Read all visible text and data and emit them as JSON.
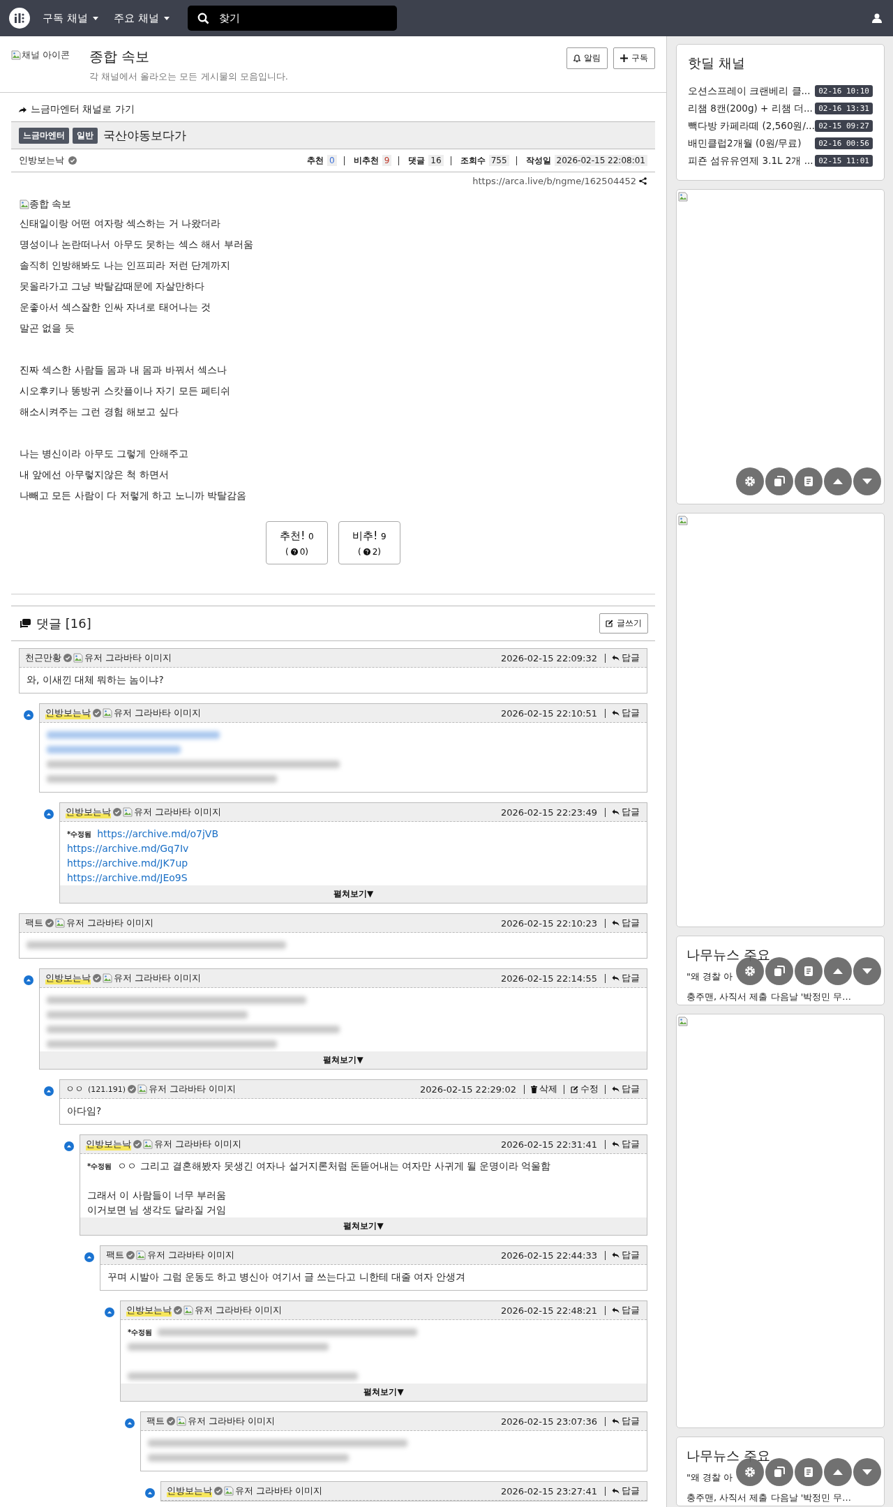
{
  "header": {
    "menus": [
      "구독 채널",
      "주요 채널"
    ],
    "search": {
      "placeholder": "찾기"
    }
  },
  "channel": {
    "icon_alt": "채널 아이콘",
    "title": "종합 속보",
    "description": "각 채널에서 올라오는 모든 게시물의 모음입니다.",
    "buttons": [
      {
        "kind": "bell",
        "label": "알림"
      },
      {
        "kind": "plus",
        "label": "구독"
      }
    ]
  },
  "post": {
    "back_link": "느금마엔터 채널로 가기",
    "badges": [
      "느금마엔터",
      "일반"
    ],
    "title": "국산야동보다가",
    "author": "인방보는낙",
    "stats": [
      {
        "kind": "up",
        "label": "추천",
        "value": "0"
      },
      {
        "kind": "down",
        "label": "비추천",
        "value": "9"
      },
      {
        "kind": "plain",
        "label": "댓글",
        "value": "16"
      },
      {
        "kind": "plain",
        "label": "조회수",
        "value": "755"
      },
      {
        "kind": "plain",
        "label": "작성일",
        "value": "2026-02-15 22:08:01"
      }
    ],
    "url": "https://arca.live/b/ngme/162504452",
    "image_alt": "종합 속보",
    "paragraphs": [
      [
        "신태일이랑 어떤 여자랑 섹스하는 거 나왔더라",
        "명성이나 논란떠나서 아무도 못하는 섹스 해서 부러움",
        "솔직히 인방해봐도 나는 인프피라 저런 단계까지",
        "못올라가고 그냥 박탈감때문에 자살만하다",
        "운좋아서 섹스잘한 인싸 자녀로 태어나는 것",
        "말곤 없을 듯"
      ],
      [
        "진짜 섹스한 사람들 몸과 내 몸과 바꿔서 섹스나",
        "시오후키나 똥방귀 스캇플이나 자기 모든 페티쉬",
        "해소시켜주는 그런 경험 해보고 싶다"
      ],
      [
        "나는 병신이라 아무도 그렇게 안해주고",
        "내 앞에선 아무렇지않은 척 하면서",
        "나빼고 모든 사람이 다 저렇게 하고 노니까 박탈감옴"
      ]
    ],
    "votes": [
      {
        "label": "추천!",
        "count": "0",
        "sub_open": "(",
        "sub": "0)"
      },
      {
        "label": "비추!",
        "count": "9",
        "sub_open": "(",
        "sub": "2)"
      }
    ]
  },
  "comments": {
    "title": "댓글 [16]",
    "write_button": "글쓰기",
    "items": [
      {
        "author": "천근만황",
        "is_author": false,
        "avatar_alt": "유저 그라바타 이미지",
        "time": "2026-02-15 22:09:32",
        "actions": [
          {
            "kind": "reply",
            "label": "답글"
          }
        ],
        "content": [
          {
            "kind": "text",
            "text": "와, 이새낀 대체 뭐하는 놈이냐?"
          }
        ],
        "children": [
          {
            "author": "인방보는낙",
            "is_author": true,
            "avatar_alt": "유저 그라바타 이미지",
            "time": "2026-02-15 22:10:51",
            "actions": [
              {
                "kind": "reply",
                "label": "답글"
              }
            ],
            "content": [
              {
                "kind": "blurred_link"
              },
              {
                "kind": "blurred_link"
              },
              {
                "kind": "blurred"
              },
              {
                "kind": "blurred"
              }
            ],
            "children": [
              {
                "author": "인방보는낙",
                "is_author": true,
                "avatar_alt": "유저 그라바타 이미지",
                "time": "2026-02-15 22:23:49",
                "actions": [
                  {
                    "kind": "reply",
                    "label": "답글"
                  }
                ],
                "edited_label": "*수정됨",
                "content": [
                  {
                    "kind": "link",
                    "text": "https://archive.md/o7jVB"
                  },
                  {
                    "kind": "link",
                    "text": "https://archive.md/Gq7Iv"
                  },
                  {
                    "kind": "link",
                    "text": "https://archive.md/JK7up"
                  },
                  {
                    "kind": "link",
                    "text": "https://archive.md/JEo9S"
                  }
                ],
                "expand_label": "펼쳐보기▼"
              }
            ]
          }
        ]
      },
      {
        "author": "팩트",
        "is_author": false,
        "avatar_alt": "유저 그라바타 이미지",
        "time": "2026-02-15 22:10:23",
        "actions": [
          {
            "kind": "reply",
            "label": "답글"
          }
        ],
        "content": [
          {
            "kind": "blurred"
          }
        ],
        "children": [
          {
            "author": "인방보는낙",
            "is_author": true,
            "avatar_alt": "유저 그라바타 이미지",
            "time": "2026-02-15 22:14:55",
            "actions": [
              {
                "kind": "reply",
                "label": "답글"
              }
            ],
            "content": [
              {
                "kind": "blurred"
              },
              {
                "kind": "blurred"
              },
              {
                "kind": "blurred"
              },
              {
                "kind": "blurred"
              }
            ],
            "expand_label": "펼쳐보기▼",
            "children": [
              {
                "author": "ㅇㅇ",
                "ip": "(121.191)",
                "is_author": false,
                "avatar_alt": "유저 그라바타 이미지",
                "time": "2026-02-15 22:29:02",
                "actions": [
                  {
                    "kind": "delete",
                    "label": "삭제"
                  },
                  {
                    "kind": "edit",
                    "label": "수정"
                  },
                  {
                    "kind": "reply",
                    "label": "답글"
                  }
                ],
                "content": [
                  {
                    "kind": "text",
                    "text": "아다임?"
                  }
                ],
                "children": [
                  {
                    "author": "인방보는낙",
                    "is_author": true,
                    "avatar_alt": "유저 그라바타 이미지",
                    "time": "2026-02-15 22:31:41",
                    "actions": [
                      {
                        "kind": "reply",
                        "label": "답글"
                      }
                    ],
                    "edited_label": "*수정됨",
                    "content": [
                      {
                        "kind": "text",
                        "text": "ㅇㅇ 그리고 결혼해봤자 못생긴 여자나 설거지론처럼 돈뜯어내는 여자만 사귀게 될 운명이라 억울함"
                      },
                      {
                        "kind": "gap"
                      },
                      {
                        "kind": "text",
                        "text": "그래서 이 사람들이 너무 부러움"
                      },
                      {
                        "kind": "text",
                        "text": "이거보면 님 생각도 달라질 거임"
                      }
                    ],
                    "expand_label": "펼쳐보기▼",
                    "children": [
                      {
                        "author": "팩트",
                        "is_author": false,
                        "avatar_alt": "유저 그라바타 이미지",
                        "time": "2026-02-15 22:44:33",
                        "actions": [
                          {
                            "kind": "reply",
                            "label": "답글"
                          }
                        ],
                        "content": [
                          {
                            "kind": "text",
                            "text": "꾸며 시발아 그럼 운동도 하고 병신아 여기서 글 쓰는다고 니한테 대줄 여자 안생겨"
                          }
                        ],
                        "children": [
                          {
                            "author": "인방보는낙",
                            "is_author": true,
                            "avatar_alt": "유저 그라바타 이미지",
                            "time": "2026-02-15 22:48:21",
                            "actions": [
                              {
                                "kind": "reply",
                                "label": "답글"
                              }
                            ],
                            "edited_label": "*수정됨",
                            "content": [
                              {
                                "kind": "blurred"
                              },
                              {
                                "kind": "blurred"
                              },
                              {
                                "kind": "gap"
                              },
                              {
                                "kind": "blurred"
                              }
                            ],
                            "expand_label": "펼쳐보기▼",
                            "children": [
                              {
                                "author": "팩트",
                                "is_author": false,
                                "avatar_alt": "유저 그라바타 이미지",
                                "time": "2026-02-15 23:07:36",
                                "actions": [
                                  {
                                    "kind": "reply",
                                    "label": "답글"
                                  }
                                ],
                                "content": [
                                  {
                                    "kind": "blurred"
                                  },
                                  {
                                    "kind": "blurred"
                                  }
                                ],
                                "children": [
                                  {
                                    "author": "인방보는낙",
                                    "is_author": true,
                                    "avatar_alt": "유저 그라바타 이미지",
                                    "time": "2026-02-15 23:27:41",
                                    "actions": [
                                      {
                                        "kind": "reply",
                                        "label": "답글"
                                      }
                                    ]
                                  }
                                ]
                              }
                            ]
                          }
                        ]
                      }
                    ]
                  }
                ]
              }
            ]
          }
        ]
      }
    ]
  },
  "sidebar": [
    {
      "kind": "hotdeal",
      "title": "핫딜 채널",
      "items": [
        {
          "title": "오션스프레이 크랜베리 클...",
          "time": "02-16 10:10"
        },
        {
          "title": "리챔 8캔(200g) + 리챔 더...",
          "time": "02-16 13:31"
        },
        {
          "title": "빽다방 카페라떼 (2,560원/...",
          "time": "02-15 09:27"
        },
        {
          "title": "배민클럽2개월 (0원/무료)",
          "time": "02-16 00:56"
        },
        {
          "title": "피죤 섬유유연제 3.1L 2개 ...",
          "time": "02-15 11:01"
        }
      ]
    },
    {
      "kind": "ad",
      "toolbar": true
    },
    {
      "kind": "ad",
      "toolbar": false
    },
    {
      "kind": "news",
      "title": "나무뉴스 주요",
      "lines": [
        "\"왜 경찰 아",
        "충주맨, 사직서 제출 다음날 '박정민 무..."
      ],
      "toolbar": true
    },
    {
      "kind": "ad",
      "toolbar": false
    },
    {
      "kind": "news",
      "title": "나무뉴스 주요",
      "lines": [
        "\"왜 경찰 아",
        "충주맨, 사직서 제출 다음날 '박정민 무..."
      ],
      "toolbar": true
    }
  ]
}
